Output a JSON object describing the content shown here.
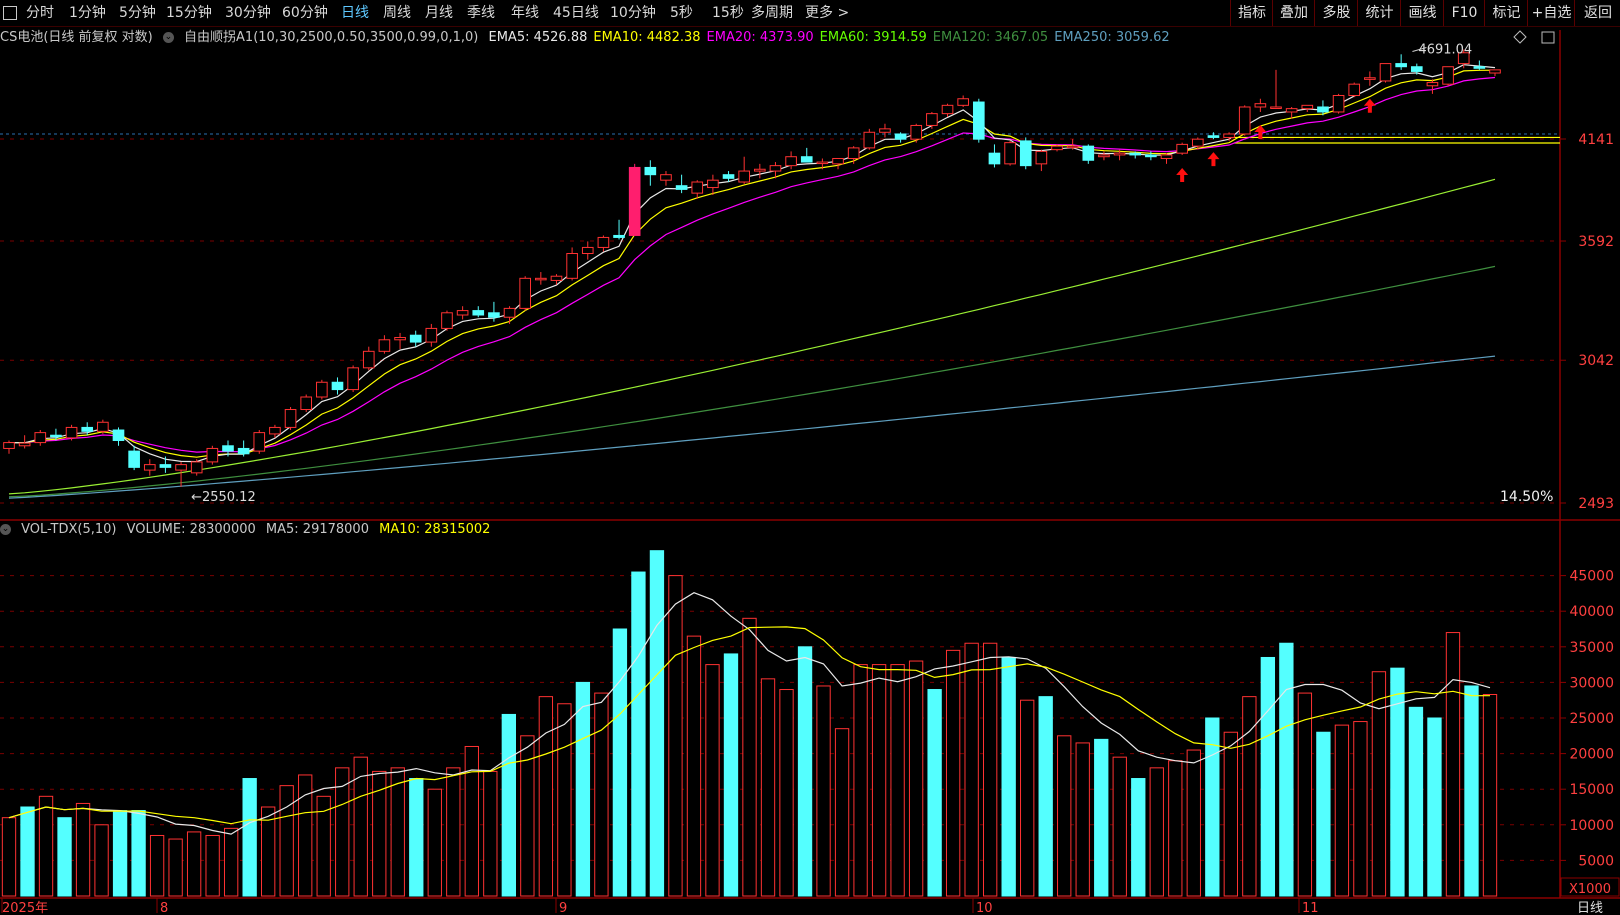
{
  "toolbar": {
    "period_tabs": [
      "分时",
      "1分钟",
      "5分钟",
      "15分钟",
      "30分钟",
      "60分钟",
      "日线",
      "周线",
      "月线",
      "季线",
      "年线",
      "45日线",
      "10分钟",
      "5秒",
      "15秒",
      "多周期",
      "更多 >"
    ],
    "active_tab": "日线",
    "right_buttons": [
      "指标",
      "叠加",
      "多股",
      "统计",
      "画线",
      "F10",
      "标记",
      "+自选",
      "返回"
    ]
  },
  "indicator_line": {
    "title": "CS电池(日线 前复权 对数)",
    "formula": "自由顺拐A1(10,30,2500,0.50,3500,0.99,0,1,0)",
    "emas": [
      {
        "label": "EMA5: 4526.88",
        "color": "#e8e8e8"
      },
      {
        "label": "EMA10: 4482.38",
        "color": "#ffff00"
      },
      {
        "label": "EMA20: 4373.90",
        "color": "#ff00ff"
      },
      {
        "label": "EMA60: 3914.59",
        "color": "#66ff00"
      },
      {
        "label": "EMA120: 3467.05",
        "color": "#3f8f3f"
      },
      {
        "label": "EMA250: 3059.62",
        "color": "#5f9fbf"
      }
    ]
  },
  "price_axis": {
    "labels": [
      "4141",
      "3592",
      "3042",
      "2493"
    ]
  },
  "price_annotations": {
    "high": "4691.04",
    "low": "2550.12",
    "percent": "14.50%"
  },
  "volume_line": {
    "title": "VOL-TDX(5,10)",
    "volume": "VOLUME: 28300000",
    "ma5": "MA5: 29178000",
    "ma10": "MA10: 28315002"
  },
  "volume_axis": {
    "labels": [
      "45000",
      "40000",
      "35000",
      "30000",
      "25000",
      "20000",
      "15000",
      "10000",
      "5000"
    ],
    "unit": "X1000"
  },
  "date_axis": {
    "labels": [
      "2025年",
      "8",
      "9",
      "10",
      "11"
    ]
  },
  "corner_label": "日线",
  "colors": {
    "up": "#ff3232",
    "down": "#54ffff",
    "bigUp": "#ff1e6e",
    "grid": "#8b0000",
    "ema5": "#e8e8e8",
    "ema10": "#ffff00",
    "ema20": "#ff00ff",
    "ema60": "#99ee33",
    "ema120": "#3f8f3f",
    "ema250": "#5f9fbf"
  },
  "chart_data": {
    "type": "candlestick",
    "price_scale": "log",
    "ylim": [
      2493,
      4900
    ],
    "candles": [
      [
        2690,
        2720,
        2670,
        2712
      ],
      [
        2700,
        2740,
        2690,
        2710
      ],
      [
        2712,
        2760,
        2700,
        2750
      ],
      [
        2740,
        2765,
        2720,
        2735
      ],
      [
        2730,
        2780,
        2720,
        2770
      ],
      [
        2770,
        2790,
        2740,
        2755
      ],
      [
        2755,
        2800,
        2745,
        2790
      ],
      [
        2760,
        2770,
        2700,
        2720
      ],
      [
        2680,
        2700,
        2610,
        2620
      ],
      [
        2610,
        2650,
        2590,
        2630
      ],
      [
        2630,
        2660,
        2600,
        2620
      ],
      [
        2610,
        2640,
        2550,
        2630
      ],
      [
        2600,
        2650,
        2590,
        2640
      ],
      [
        2640,
        2700,
        2630,
        2690
      ],
      [
        2700,
        2720,
        2660,
        2680
      ],
      [
        2690,
        2720,
        2660,
        2670
      ],
      [
        2680,
        2760,
        2670,
        2750
      ],
      [
        2745,
        2780,
        2730,
        2770
      ],
      [
        2770,
        2850,
        2760,
        2840
      ],
      [
        2840,
        2900,
        2830,
        2890
      ],
      [
        2890,
        2960,
        2880,
        2950
      ],
      [
        2950,
        2970,
        2900,
        2920
      ],
      [
        2920,
        3020,
        2910,
        3010
      ],
      [
        3010,
        3100,
        3000,
        3080
      ],
      [
        3080,
        3150,
        3070,
        3130
      ],
      [
        3130,
        3160,
        3090,
        3140
      ],
      [
        3150,
        3170,
        3100,
        3120
      ],
      [
        3120,
        3200,
        3100,
        3180
      ],
      [
        3180,
        3260,
        3170,
        3250
      ],
      [
        3240,
        3280,
        3220,
        3260
      ],
      [
        3260,
        3280,
        3230,
        3240
      ],
      [
        3250,
        3300,
        3210,
        3230
      ],
      [
        3230,
        3280,
        3200,
        3270
      ],
      [
        3270,
        3420,
        3260,
        3410
      ],
      [
        3410,
        3440,
        3380,
        3410
      ],
      [
        3400,
        3430,
        3380,
        3420
      ],
      [
        3410,
        3560,
        3400,
        3530
      ],
      [
        3530,
        3590,
        3500,
        3560
      ],
      [
        3560,
        3620,
        3540,
        3610
      ],
      [
        3620,
        3700,
        3600,
        3610
      ],
      [
        3620,
        4000,
        3620,
        3980
      ],
      [
        3980,
        4020,
        3880,
        3940
      ],
      [
        3910,
        3960,
        3880,
        3940
      ],
      [
        3880,
        3940,
        3840,
        3860
      ],
      [
        3840,
        3910,
        3810,
        3900
      ],
      [
        3870,
        3940,
        3830,
        3910
      ],
      [
        3940,
        3960,
        3900,
        3920
      ],
      [
        3900,
        4040,
        3890,
        3960
      ],
      [
        3960,
        4000,
        3920,
        3970
      ],
      [
        3960,
        4010,
        3920,
        3990
      ],
      [
        3990,
        4070,
        3970,
        4040
      ],
      [
        4040,
        4090,
        4010,
        4010
      ],
      [
        4010,
        4030,
        3970,
        4010
      ],
      [
        4000,
        4030,
        3970,
        4030
      ],
      [
        4030,
        4100,
        4000,
        4090
      ],
      [
        4090,
        4200,
        4080,
        4180
      ],
      [
        4180,
        4230,
        4150,
        4200
      ],
      [
        4170,
        4180,
        4120,
        4140
      ],
      [
        4140,
        4230,
        4120,
        4220
      ],
      [
        4220,
        4300,
        4200,
        4290
      ],
      [
        4290,
        4350,
        4270,
        4340
      ],
      [
        4340,
        4400,
        4330,
        4380
      ],
      [
        4360,
        4380,
        4120,
        4140
      ],
      [
        4060,
        4110,
        3980,
        4000
      ],
      [
        4000,
        4130,
        3990,
        4120
      ],
      [
        4130,
        4150,
        3970,
        3990
      ],
      [
        4000,
        4080,
        3960,
        4070
      ],
      [
        4080,
        4110,
        4070,
        4100
      ],
      [
        4100,
        4140,
        4080,
        4100
      ],
      [
        4100,
        4110,
        4000,
        4020
      ],
      [
        4040,
        4070,
        4020,
        4050
      ],
      [
        4050,
        4080,
        4020,
        4060
      ],
      [
        4060,
        4070,
        4030,
        4050
      ],
      [
        4050,
        4070,
        4020,
        4040
      ],
      [
        4030,
        4060,
        4000,
        4050
      ],
      [
        4060,
        4120,
        4050,
        4110
      ],
      [
        4100,
        4150,
        4080,
        4140
      ],
      [
        4160,
        4180,
        4140,
        4150
      ],
      [
        4150,
        4180,
        4130,
        4170
      ],
      [
        4170,
        4340,
        4160,
        4330
      ],
      [
        4330,
        4380,
        4300,
        4350
      ],
      [
        4330,
        4560,
        4320,
        4330
      ],
      [
        4300,
        4330,
        4260,
        4320
      ],
      [
        4320,
        4340,
        4300,
        4340
      ],
      [
        4330,
        4370,
        4280,
        4300
      ],
      [
        4300,
        4410,
        4290,
        4400
      ],
      [
        4400,
        4480,
        4390,
        4470
      ],
      [
        4500,
        4550,
        4460,
        4510
      ],
      [
        4490,
        4600,
        4480,
        4600
      ],
      [
        4600,
        4660,
        4560,
        4580
      ],
      [
        4580,
        4600,
        4530,
        4550
      ],
      [
        4460,
        4500,
        4410,
        4480
      ],
      [
        4470,
        4580,
        4460,
        4580
      ],
      [
        4600,
        4691.04,
        4570,
        4670
      ],
      [
        4580,
        4620,
        4560,
        4570
      ],
      [
        4540,
        4560,
        4520,
        4560
      ]
    ],
    "bigUp_index": 40,
    "arrow_indices": [
      75,
      77,
      80,
      87
    ],
    "volume": [
      11000,
      12500,
      14000,
      11000,
      13000,
      10000,
      12000,
      12000,
      8500,
      8000,
      9000,
      8500,
      9500,
      16500,
      12500,
      15500,
      17000,
      14000,
      18000,
      19500,
      17500,
      18000,
      16500,
      15000,
      18000,
      21000,
      17500,
      25500,
      22500,
      28000,
      27000,
      30000,
      28500,
      37500,
      45500,
      48500,
      45000,
      36500,
      32500,
      34000,
      39000,
      30500,
      29000,
      35000,
      29500,
      23500,
      32500,
      32500,
      32500,
      33000,
      29000,
      34500,
      35500,
      35500,
      33500,
      27500,
      28000,
      22500,
      21500,
      22000,
      19500,
      16500,
      18000,
      19000,
      20500,
      25000,
      23000,
      28000,
      33500,
      35500,
      28500,
      23000,
      24000,
      24500,
      31500,
      32000,
      26500,
      25000,
      37000,
      29500,
      28300
    ],
    "volume_up": [
      1,
      0,
      1,
      0,
      1,
      1,
      0,
      0,
      1,
      1,
      1,
      1,
      1,
      0,
      1,
      1,
      1,
      1,
      1,
      1,
      1,
      1,
      0,
      1,
      1,
      1,
      1,
      0,
      1,
      1,
      1,
      0,
      1,
      0,
      0,
      0,
      1,
      1,
      1,
      0,
      1,
      1,
      1,
      0,
      1,
      1,
      1,
      1,
      1,
      1,
      0,
      1,
      1,
      1,
      0,
      1,
      0,
      1,
      1,
      0,
      1,
      0,
      1,
      1,
      1,
      0,
      1,
      1,
      0,
      0,
      1,
      0,
      1,
      1,
      1,
      0,
      0,
      0,
      1,
      0,
      1
    ],
    "volume_ylim": [
      0,
      50000
    ]
  }
}
